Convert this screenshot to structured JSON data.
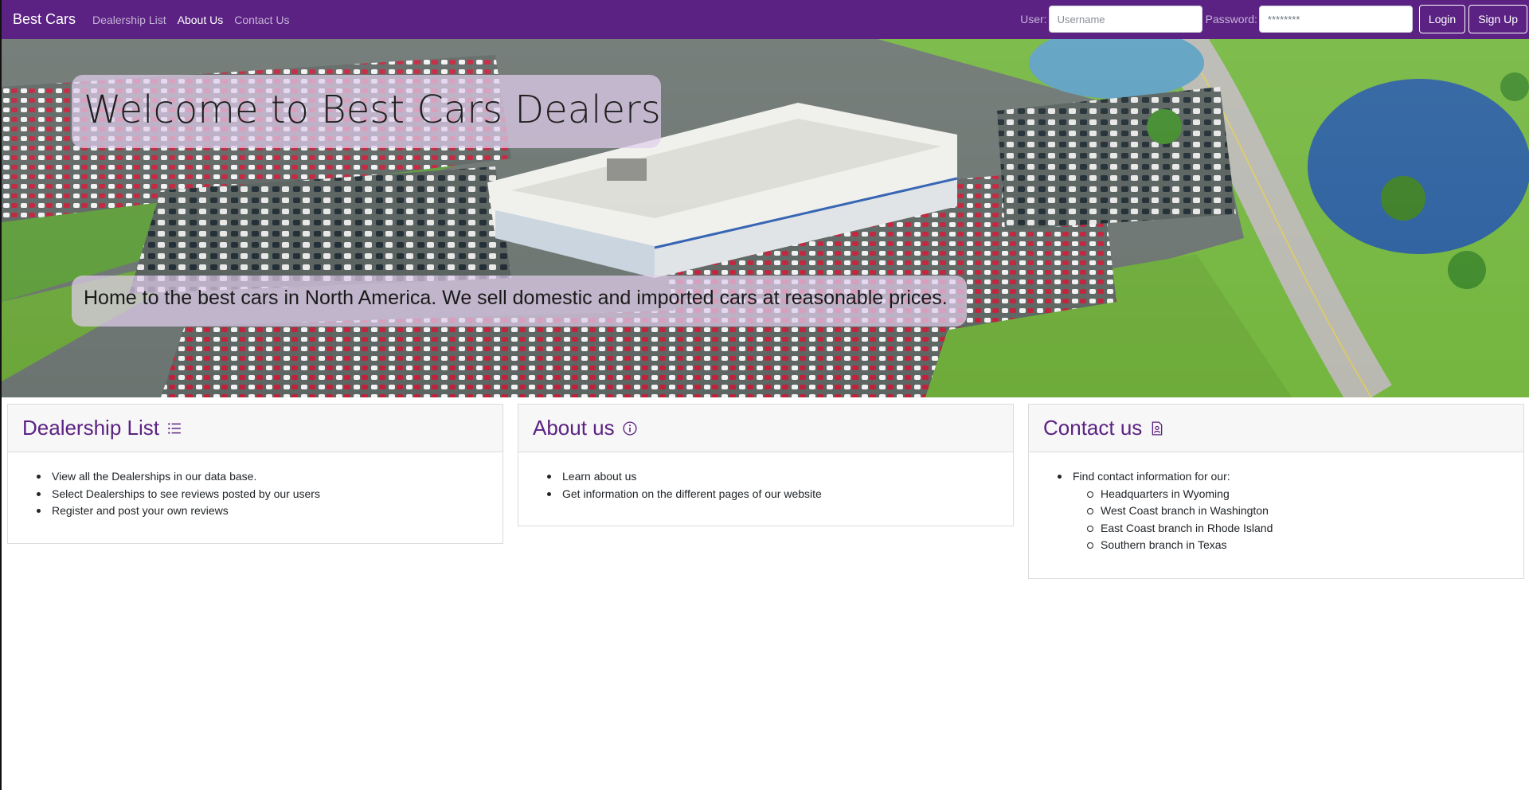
{
  "navbar": {
    "brand": "Best Cars",
    "links": [
      {
        "label": "Dealership List",
        "active": false
      },
      {
        "label": "About Us",
        "active": true
      },
      {
        "label": "Contact Us",
        "active": false
      }
    ],
    "user_label": "User:",
    "username_placeholder": "Username",
    "password_label": "Password:",
    "password_value": "********",
    "login_label": "Login",
    "signup_label": "Sign Up"
  },
  "hero": {
    "title": "Welcome to Best Cars Dealership!",
    "subtitle": "Home to the best cars in North America. We sell domestic and imported cars at reasonable prices."
  },
  "cards": [
    {
      "title": "Dealership List",
      "icon": "list-icon",
      "items": [
        "View all the Dealerships in our data base.",
        "Select Dealerships to see reviews posted by our users",
        "Register and post your own reviews"
      ]
    },
    {
      "title": "About us",
      "icon": "info-icon",
      "items": [
        "Learn about us",
        "Get information on the different pages of our website"
      ]
    },
    {
      "title": "Contact us",
      "icon": "contact-document-icon",
      "items": [
        "Find contact information for our:"
      ],
      "sub_items": [
        "Headquarters in Wyoming",
        "West Coast branch in Washington",
        "East Coast branch in Rhode Island",
        "Southern branch in Texas"
      ]
    }
  ],
  "colors": {
    "navbar_bg": "#5b2283",
    "accent": "#5b2283",
    "hero_overlay": "#e1cdeb"
  }
}
